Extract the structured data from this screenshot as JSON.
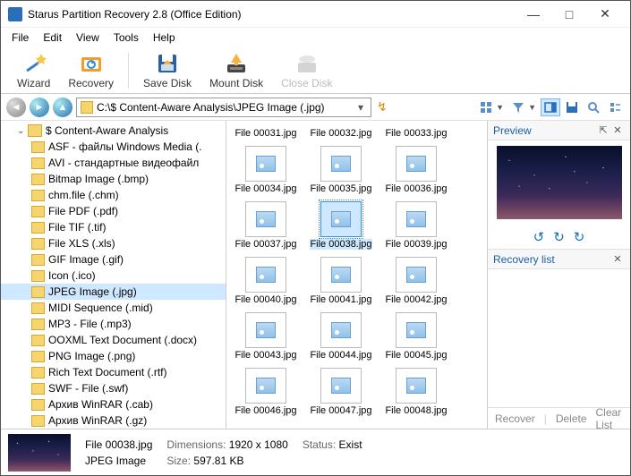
{
  "window": {
    "title": "Starus Partition Recovery 2.8 (Office Edition)"
  },
  "menu": {
    "file": "File",
    "edit": "Edit",
    "view": "View",
    "tools": "Tools",
    "help": "Help"
  },
  "toolbar": {
    "wizard": "Wizard",
    "recovery": "Recovery",
    "save_disk": "Save Disk",
    "mount_disk": "Mount Disk",
    "close_disk": "Close Disk"
  },
  "path": "C:\\$ Content-Aware Analysis\\JPEG Image (.jpg)",
  "tree": {
    "root": "$ Content-Aware Analysis",
    "items": [
      "ASF - файлы Windows Media (.",
      "AVI - стандартные видеофайл",
      "Bitmap Image (.bmp)",
      "chm.file (.chm)",
      "File PDF (.pdf)",
      "File TIF (.tif)",
      "File XLS (.xls)",
      "GIF Image (.gif)",
      "Icon (.ico)",
      "JPEG Image (.jpg)",
      "MIDI Sequence (.mid)",
      "MP3 - File (.mp3)",
      "OOXML Text Document (.docx)",
      "PNG Image (.png)",
      "Rich Text Document (.rtf)",
      "SWF - File (.swf)",
      "Архив WinRAR (.cab)",
      "Архив WinRAR (.gz)"
    ],
    "selected_index": 9
  },
  "files": [
    "File 00031.jpg",
    "File 00032.jpg",
    "File 00033.jpg",
    "File 00034.jpg",
    "File 00035.jpg",
    "File 00036.jpg",
    "File 00037.jpg",
    "File 00038.jpg",
    "File 00039.jpg",
    "File 00040.jpg",
    "File 00041.jpg",
    "File 00042.jpg",
    "File 00043.jpg",
    "File 00044.jpg",
    "File 00045.jpg",
    "File 00046.jpg",
    "File 00047.jpg",
    "File 00048.jpg"
  ],
  "selected_file_index": 7,
  "preview": {
    "title": "Preview"
  },
  "recovery_list": {
    "title": "Recovery list",
    "recover": "Recover",
    "delete": "Delete",
    "clear": "Clear List"
  },
  "status": {
    "filename": "File 00038.jpg",
    "type": "JPEG Image",
    "dim_label": "Dimensions:",
    "dimensions": "1920 x 1080",
    "size_label": "Size:",
    "size": "597.81 KB",
    "status_label": "Status:",
    "status": "Exist"
  }
}
